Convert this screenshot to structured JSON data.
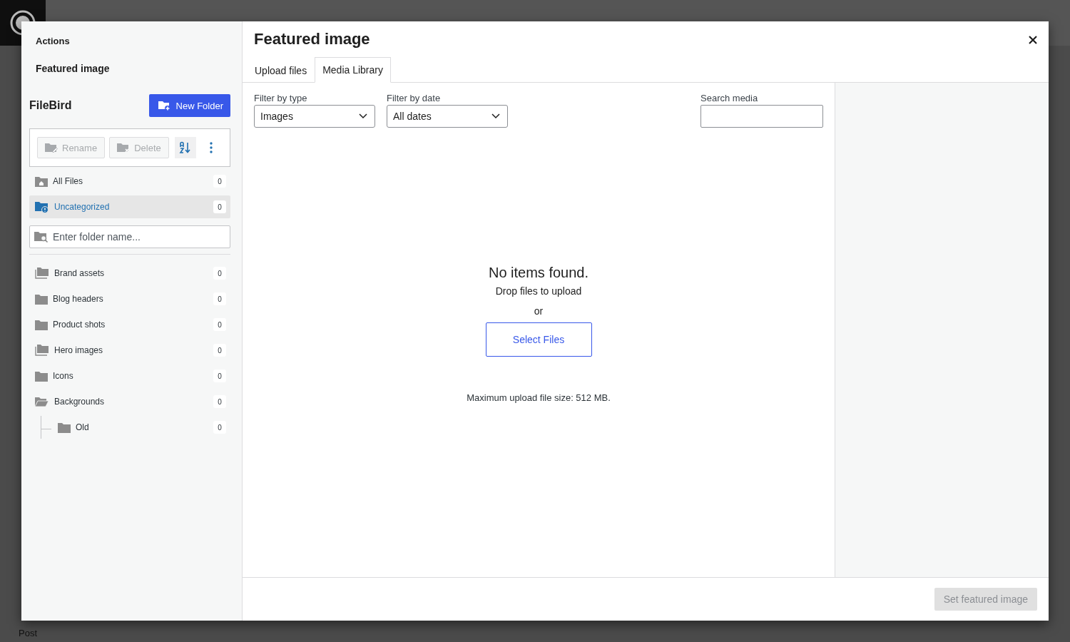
{
  "backdrop": {
    "footer_text": "Post"
  },
  "sidebar": {
    "actions_title": "Actions",
    "featured_title": "Featured image",
    "plugin_name": "FileBird",
    "new_folder_button": "New Folder",
    "toolbar": [
      {
        "label": "Rename",
        "kind": "rename",
        "disabled": true
      },
      {
        "label": "Delete",
        "kind": "delete",
        "disabled": true
      }
    ],
    "special_folders": [
      {
        "name": "All Files",
        "count": "0",
        "kind": "home",
        "selected": false
      },
      {
        "name": "Uncategorized",
        "count": "0",
        "kind": "uncategorized",
        "selected": true
      }
    ],
    "folder_search": {
      "placeholder": "Enter folder name..."
    },
    "folders": [
      {
        "name": "Brand assets",
        "count": "0",
        "kind": "stack",
        "selected": false
      },
      {
        "name": "Blog headers",
        "count": "0",
        "kind": "folder",
        "selected": false
      },
      {
        "name": "Product shots",
        "count": "0",
        "kind": "folder",
        "selected": false
      },
      {
        "name": "Hero images",
        "count": "0",
        "kind": "stack",
        "selected": false
      },
      {
        "name": "Icons",
        "count": "0",
        "kind": "folder",
        "selected": false
      },
      {
        "name": "Backgrounds",
        "count": "0",
        "kind": "folder",
        "selected": false,
        "expanded": true,
        "children": [
          {
            "name": "Old",
            "count": "0",
            "kind": "folder",
            "selected": false
          }
        ]
      }
    ]
  },
  "modal": {
    "title": "Featured image",
    "tabs": [
      {
        "label": "Upload files",
        "selected": false
      },
      {
        "label": "Media Library",
        "selected": true
      }
    ],
    "filters": [
      {
        "label": "Filter by type",
        "value": "Images"
      },
      {
        "label": "Filter by date",
        "value": "All dates"
      }
    ],
    "search": {
      "label": "Search media"
    },
    "empty_state": {
      "title": "No items found.",
      "subtitle": "Drop files to upload",
      "separator": "or",
      "button": "Select Files",
      "note": "Maximum upload file size: 512 MB."
    },
    "footer_button": {
      "label": "Set featured image",
      "disabled": true
    }
  }
}
